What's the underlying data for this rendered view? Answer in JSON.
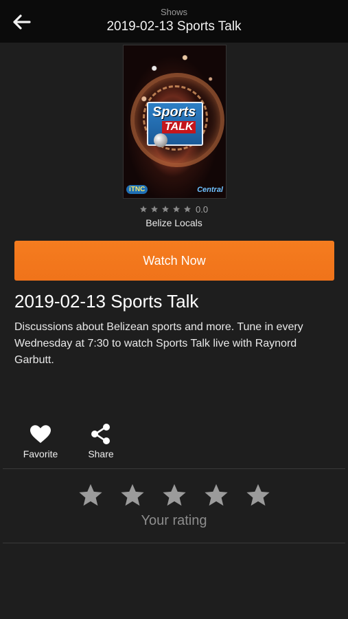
{
  "topbar": {
    "subtitle": "Shows",
    "title": "2019-02-13 Sports Talk",
    "back_icon": "arrow-left-icon"
  },
  "poster": {
    "logo_line1": "Sports",
    "logo_line2": "TALK",
    "brand_left": "iTNC",
    "brand_right": "Central"
  },
  "rating": {
    "stars": 5,
    "value": "0.0"
  },
  "category": "Belize Locals",
  "watch_button": "Watch Now",
  "show": {
    "title": "2019-02-13 Sports Talk",
    "description": "Discussions about Belizean sports and more. Tune in every Wednesday at 7:30 to watch Sports Talk live with Raynord Garbutt."
  },
  "actions": {
    "favorite": "Favorite",
    "share": "Share"
  },
  "user_rating": {
    "label": "Your rating",
    "stars": 5
  },
  "colors": {
    "accent": "#f57c1f",
    "background": "#1e1e1e",
    "topbar": "#0b0b0b",
    "star": "#9b9b9b"
  }
}
